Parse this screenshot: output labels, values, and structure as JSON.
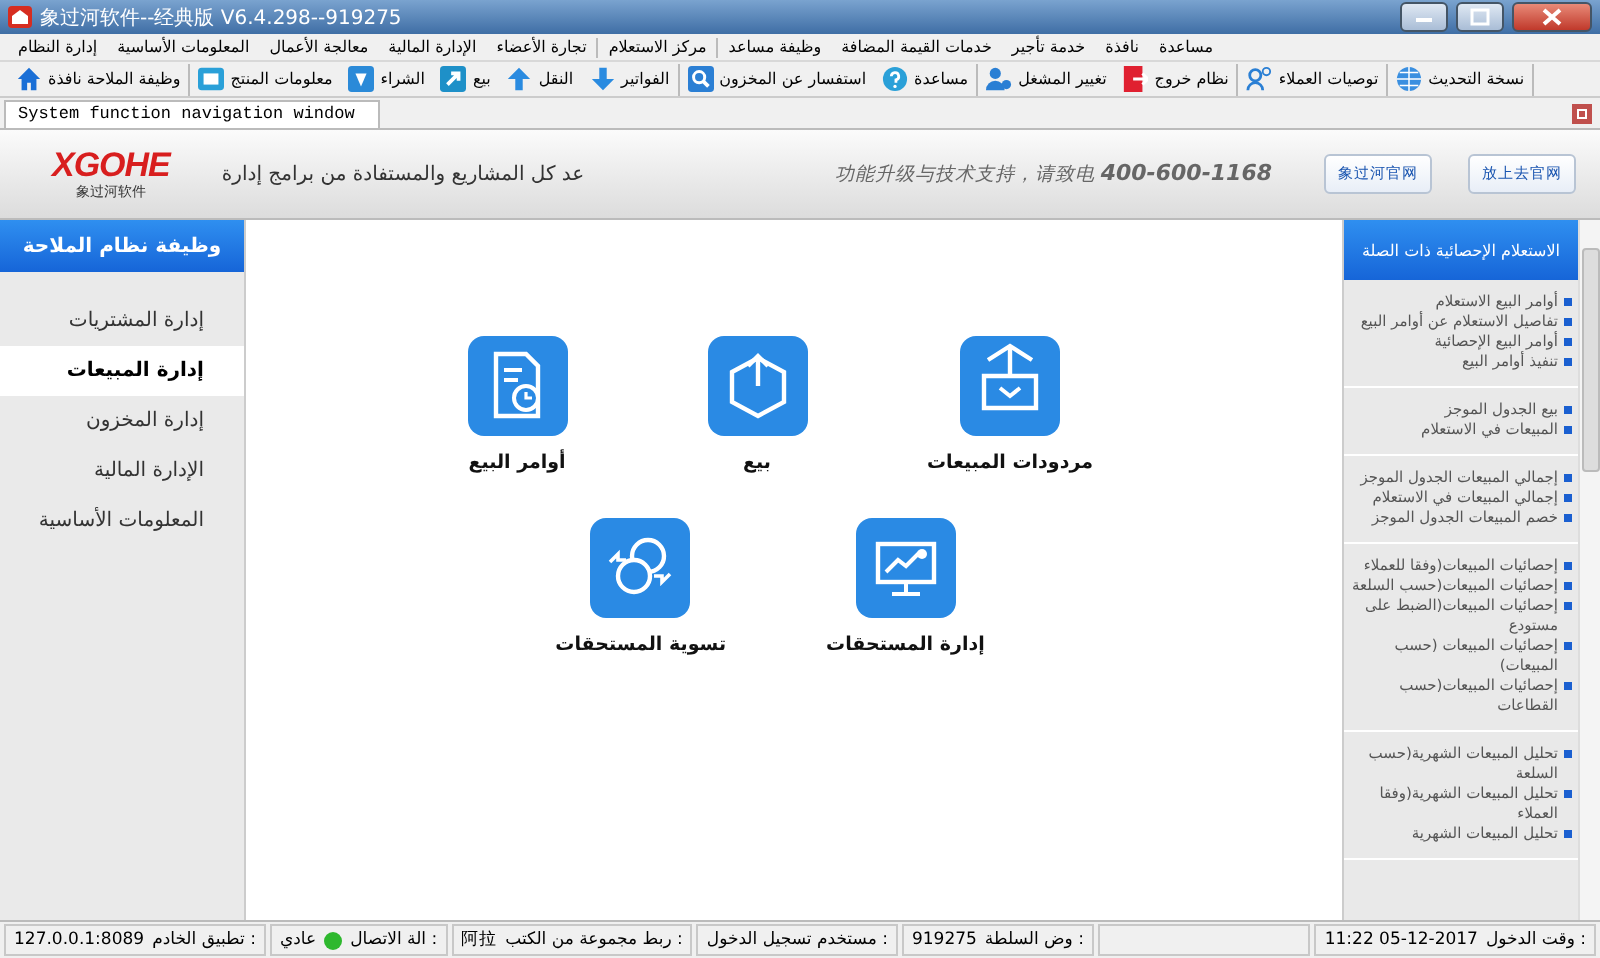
{
  "window": {
    "title": "象过河软件--经典版 V6.4.298--919275"
  },
  "menu": [
    "مساعدة",
    "نافذة",
    "خدمة تأجير",
    "خدمات القيمة المضافة",
    "وظيفة مساعد",
    "مركز الاستعلام",
    "تجارة الأعضاء",
    "الإدارة المالية",
    "معالجة الأعمال",
    "المعلومات الأساسية",
    "إدارة النظام"
  ],
  "toolbar": [
    {
      "label": "نسخة التحديث"
    },
    {
      "label": "توصيات العملاء"
    },
    {
      "label": "نظام خروج"
    },
    {
      "label": "تغيير المشغل"
    },
    {
      "label": "مساعدة"
    },
    {
      "label": "استفسار عن المخزون"
    },
    {
      "label": "الفواتير"
    },
    {
      "label": "النقل"
    },
    {
      "label": "بيع"
    },
    {
      "label": "الشراء"
    },
    {
      "label": "معلومات المنتج"
    },
    {
      "label": "وظيفة الملاحة نافذة"
    }
  ],
  "tabs": [
    {
      "label": "System function navigation window",
      "selected": true
    }
  ],
  "header": {
    "logo": "XGOHE",
    "logo_subtitle": "象过河软件",
    "slogan": "عد كل المشاريع والمستفادة من برامج إدارة",
    "support": "功能升级与技术支持，请致电",
    "phone": "400-600-1168",
    "links": [
      "放上去官网",
      "象过河官网"
    ]
  },
  "sidebar": {
    "title": "وظيفة نظام الملاحة",
    "items": [
      {
        "label": "إدارة المشتريات",
        "selected": false
      },
      {
        "label": "إدارة المبيعات",
        "selected": true
      },
      {
        "label": "إدارة المخزون",
        "selected": false
      },
      {
        "label": "الإدارة المالية",
        "selected": false
      },
      {
        "label": "المعلومات الأساسية",
        "selected": false
      }
    ]
  },
  "function_rows": [
    {
      "items": [
        "مردودات المبيعات",
        "بيع",
        "أوامر البيع"
      ]
    },
    {
      "items": [
        "إدارة المستحقات",
        "تسوية المستحقات"
      ]
    }
  ],
  "query_panel": {
    "title": "الاستعلام الإحصائية ذات الصلة",
    "groups": [
      {
        "items": [
          "أوامر البيع الاستعلام",
          "تفاصيل الاستعلام عن أوامر البيع",
          "أوامر البيع الإحصائية",
          "تنفيذ أوامر البيع"
        ]
      },
      {
        "items": [
          "بيع الجدول الموجز",
          "المبيعات في الاستعلام"
        ]
      },
      {
        "items": [
          "إجمالي المبيعات الجدول الموجز",
          "إجمالي المبيعات في الاستعلام",
          "خصم المبيعات الجدول الموجز"
        ]
      },
      {
        "items": [
          "إحصائيات المبيعات(وفقا للعملاء",
          "إحصائيات المبيعات(حسب السلعة",
          "إحصائيات المبيعات(الضبط على مستودع",
          "إحصائيات المبيعات (حسب المبيعات)",
          "إحصائيات المبيعات(حسب القطاعات"
        ]
      },
      {
        "items": [
          "تحليل المبيعات الشهرية(حسب السلعة",
          "تحليل المبيعات الشهرية(وفقا العملاء",
          "تحليل المبيعات الشهرية"
        ]
      }
    ]
  },
  "status_bar": [
    {
      "label": "وقت الدخول :",
      "value": "11:22 05-12-2017"
    },
    {
      "label": "وض السلطة :",
      "value": "919275"
    },
    {
      "label": "مستخدم تسجيل الدخول :"
    },
    {
      "label": "ربط مجموعة من الكتب :",
      "value": "阿拉"
    },
    {
      "label": "الة الاتصال :",
      "value": "عادي",
      "online": true
    },
    {
      "label": "تطبيق الخادم :",
      "value": "127.0.0.1:8089"
    }
  ]
}
